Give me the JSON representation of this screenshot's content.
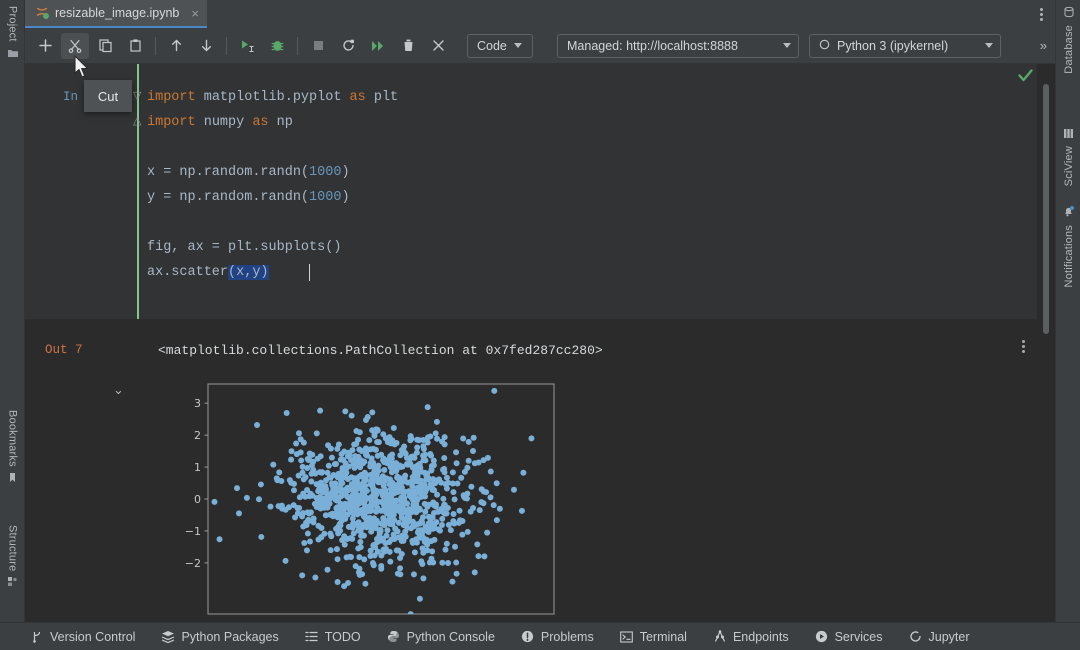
{
  "window": {
    "title_tab": "resizable_image.ipynb",
    "tab_icon": "jupyter-notebook-icon",
    "tab_close_glyph": "×",
    "overflow_menu": "kebab-menu-icon"
  },
  "left_rail": [
    {
      "label": "Project",
      "icon": "folder-icon"
    },
    {
      "label": "Bookmarks",
      "icon": "bookmark-icon"
    },
    {
      "label": "Structure",
      "icon": "structure-icon"
    }
  ],
  "right_rail": [
    {
      "label": "Database",
      "icon": "database-icon"
    },
    {
      "label": "SciView",
      "icon": "sciview-grid-icon"
    },
    {
      "label": "Notifications",
      "icon": "bell-icon"
    }
  ],
  "toolbar": {
    "buttons": [
      {
        "name": "add-cell-button",
        "icon": "plus-icon",
        "tooltip": ""
      },
      {
        "name": "cut-cell-button",
        "icon": "scissors-icon",
        "tooltip": "Cut"
      },
      {
        "name": "copy-cell-button",
        "icon": "copy-icon",
        "tooltip": ""
      },
      {
        "name": "paste-cell-button",
        "icon": "paste-icon",
        "tooltip": ""
      },
      {
        "name": "move-cell-up-button",
        "icon": "arrow-up-icon",
        "tooltip": ""
      },
      {
        "name": "move-cell-down-button",
        "icon": "arrow-down-icon",
        "tooltip": ""
      },
      {
        "name": "run-cell-button",
        "icon": "run-play-icon",
        "tooltip": ""
      },
      {
        "name": "debug-cell-button",
        "icon": "bug-icon",
        "tooltip": ""
      },
      {
        "name": "stop-button",
        "icon": "stop-square-icon",
        "tooltip": ""
      },
      {
        "name": "restart-kernel-button",
        "icon": "restart-icon",
        "tooltip": ""
      },
      {
        "name": "run-all-button",
        "icon": "double-chevron-right-icon",
        "tooltip": ""
      },
      {
        "name": "delete-cell-button",
        "icon": "trash-icon",
        "tooltip": ""
      },
      {
        "name": "interrupt-button",
        "icon": "close-x-icon",
        "tooltip": ""
      }
    ],
    "cell_type": "Code",
    "server": "Managed: http://localhost:8888",
    "kernel": "Python 3 (ipykernel)",
    "overflow": "»",
    "active_tooltip": "Cut"
  },
  "editor": {
    "prompt_in": "In",
    "code_lines": [
      [
        {
          "t": "import ",
          "c": "kw"
        },
        {
          "t": "matplotlib.pyplot ",
          "c": ""
        },
        {
          "t": "as ",
          "c": "kw"
        },
        {
          "t": "plt",
          "c": ""
        }
      ],
      [
        {
          "t": "import ",
          "c": "kw"
        },
        {
          "t": "numpy ",
          "c": ""
        },
        {
          "t": "as ",
          "c": "kw"
        },
        {
          "t": "np",
          "c": ""
        }
      ],
      [
        {
          "t": "",
          "c": ""
        }
      ],
      [
        {
          "t": "x = np.random.randn(",
          "c": ""
        },
        {
          "t": "1000",
          "c": "num"
        },
        {
          "t": ")",
          "c": ""
        }
      ],
      [
        {
          "t": "y = np.random.randn(",
          "c": ""
        },
        {
          "t": "1000",
          "c": "num"
        },
        {
          "t": ")",
          "c": ""
        }
      ],
      [
        {
          "t": "",
          "c": ""
        }
      ],
      [
        {
          "t": "fig, ax = plt.subplots()",
          "c": ""
        }
      ],
      [
        {
          "t": "ax.scatter",
          "c": ""
        },
        {
          "t": "(x,y)",
          "c": "sel"
        }
      ]
    ],
    "status_icon": "checkmark-ok-icon"
  },
  "output": {
    "prompt_out": "Out",
    "prompt_number": "7",
    "text": "<matplotlib.collections.PathCollection at 0x7fed287cc280>",
    "kebab": "output-options-icon",
    "collapse_glyph": "⌄"
  },
  "chart_data": {
    "type": "scatter",
    "title": "",
    "xlabel": "",
    "ylabel": "",
    "yticks": [
      3,
      2,
      1,
      0,
      -1,
      -2
    ],
    "ytick_labels": [
      "3",
      "2",
      "1",
      "0",
      "−1",
      "−2"
    ],
    "ylim": [
      -3.6,
      3.6
    ],
    "xlim": [
      -3.6,
      3.6
    ],
    "grid": false,
    "legend": null,
    "n_points": 1000,
    "marker_color": "#7ab0d8",
    "marker_size": 6,
    "distribution": "standard normal (randn) in both x and y",
    "series": [
      {
        "name": "scatter(x, y)",
        "x_mean": 0,
        "y_mean": 0,
        "x_std": 1,
        "y_std": 1
      }
    ]
  },
  "statusbar": [
    {
      "label": "Version Control",
      "icon": "branch-icon"
    },
    {
      "label": "Python Packages",
      "icon": "packages-icon"
    },
    {
      "label": "TODO",
      "icon": "list-icon"
    },
    {
      "label": "Python Console",
      "icon": "python-icon"
    },
    {
      "label": "Problems",
      "icon": "warning-circle-icon"
    },
    {
      "label": "Terminal",
      "icon": "terminal-icon"
    },
    {
      "label": "Endpoints",
      "icon": "endpoints-icon"
    },
    {
      "label": "Services",
      "icon": "play-circle-icon"
    },
    {
      "label": "Jupyter",
      "icon": "jupyter-icon"
    }
  ],
  "colors": {
    "editor_bg": "#2b2b2b",
    "cell_bg": "#313335",
    "chrome_bg": "#3c3f41",
    "accent_tab": "#4a88c7",
    "run_green": "#59a869",
    "keyword_orange": "#cc7832",
    "number_blue": "#6897bb",
    "out_orange": "#cf7248",
    "scatter_blue": "#7ab0d8"
  }
}
